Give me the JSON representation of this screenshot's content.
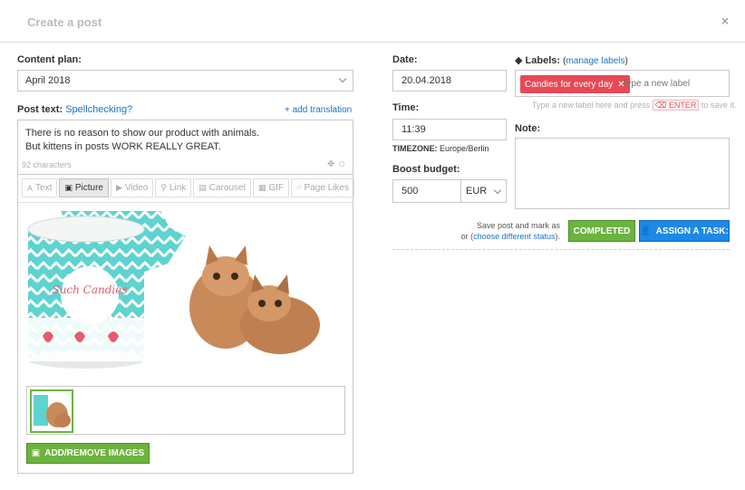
{
  "header": {
    "title": "Create a post",
    "close_glyph": "×"
  },
  "content_plan": {
    "label": "Content plan:",
    "selected": "April 2018"
  },
  "post_text": {
    "label": "Post text:",
    "spellcheck_link": "Spellchecking?",
    "add_translation_link": "+ add translation",
    "lines": [
      "There is no reason to show our product with animals.",
      "But kittens in posts WORK REALLY GREAT."
    ],
    "char_count": "92 characters"
  },
  "editor_tabs": [
    {
      "label": "Text",
      "icon": "text-icon",
      "glyph": "A"
    },
    {
      "label": "Picture",
      "icon": "picture-icon",
      "glyph": "▣"
    },
    {
      "label": "Video",
      "icon": "video-icon",
      "glyph": "▶"
    },
    {
      "label": "Link",
      "icon": "link-icon",
      "glyph": "⚲"
    },
    {
      "label": "Carousel",
      "icon": "carousel-icon",
      "glyph": "▤"
    },
    {
      "label": "GIF",
      "icon": "gif-icon",
      "glyph": "▦"
    },
    {
      "label": "Page Likes",
      "icon": "thumbs-up-icon",
      "glyph": "☝"
    }
  ],
  "media": {
    "image_text": "Such Candies",
    "add_images_label": "ADD/REMOVE IMAGES"
  },
  "date": {
    "label": "Date:",
    "value": "20.04.2018"
  },
  "time": {
    "label": "Time:",
    "value": "11:39"
  },
  "timezone": {
    "label": "TIMEZONE:",
    "value": "Europe/Berlin"
  },
  "boost": {
    "label": "Boost budget:",
    "value": "500",
    "currency": "EUR"
  },
  "labels": {
    "label": "Labels:",
    "manage_link": "manage labels",
    "tags": [
      "Candies for every day"
    ],
    "input_placeholder": "Type a new label",
    "hint_before": "Type a new label here and press",
    "hint_key": "ENTER",
    "hint_after": "to save it."
  },
  "note": {
    "label": "Note:",
    "value": ""
  },
  "actions": {
    "save_text": "Save post and mark as",
    "or_text": "or (",
    "different_status_link": "choose different status",
    "close_paren": ").",
    "completed_label": "COMPLETED",
    "assign_label": "ASSIGN A TASK:"
  },
  "colors": {
    "accent_green": "#6cb33f",
    "accent_blue": "#1e88e5",
    "tag_red": "#e84855",
    "link_blue": "#1a74c4"
  }
}
